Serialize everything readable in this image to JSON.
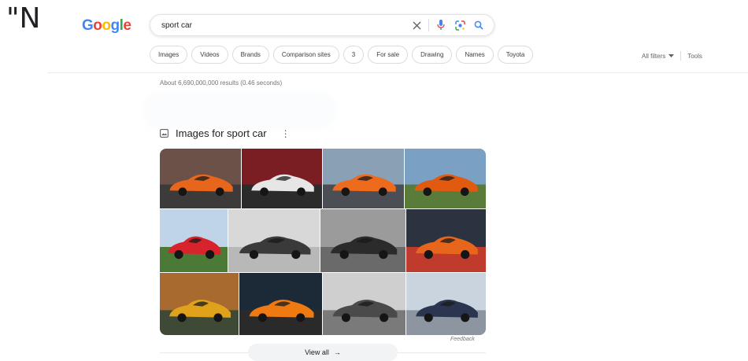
{
  "stray_text": "\"N",
  "logo": {
    "letters": [
      "G",
      "o",
      "o",
      "g",
      "l",
      "e"
    ],
    "colors": [
      "#4285F4",
      "#EA4335",
      "#FBBC05",
      "#4285F4",
      "#34A853",
      "#EA4335"
    ]
  },
  "search": {
    "query": "sport car",
    "icons": [
      "clear-icon",
      "voice-search-icon",
      "lens-icon",
      "search-icon"
    ]
  },
  "chips": [
    "Images",
    "Videos",
    "Brands",
    "Comparison sites",
    "3",
    "For sale",
    "Drawing",
    "Names",
    "Toyota"
  ],
  "tools": {
    "all_filters": "All filters",
    "tools": "Tools"
  },
  "results_stats": "About 6,690,000,000 results (0.46 seconds)",
  "images_section": {
    "heading": "Images for sport car",
    "tiles": [
      {
        "car": "#e8661c",
        "bg": "#6b5148",
        "ground": "#3d3a3a"
      },
      {
        "car": "#e6e6e6",
        "bg": "#7b1e24",
        "ground": "#2b2b2b"
      },
      {
        "car": "#ee6a1d",
        "bg": "#8aa1b5",
        "ground": "#4b4f55"
      },
      {
        "car": "#e25a10",
        "bg": "#7aa0c4",
        "ground": "#5a7c3a"
      },
      {
        "car": "#d9232c",
        "bg": "#bfd4e6",
        "ground": "#4a7a36"
      },
      {
        "car": "#3a3a3a",
        "bg": "#d8d8d8",
        "ground": "#b8b8b8"
      },
      {
        "car": "#2b2b2b",
        "bg": "#9b9b9b",
        "ground": "#6a6a6a"
      },
      {
        "car": "#e8661c",
        "bg": "#2b3340",
        "ground": "#c03a2e"
      },
      {
        "car": "#e0a21a",
        "bg": "#a86a2e",
        "ground": "#3e4a35"
      },
      {
        "car": "#f07a12",
        "bg": "#1c2a38",
        "ground": "#2a2a2a"
      },
      {
        "car": "#4a4a4a",
        "bg": "#cfcfcf",
        "ground": "#7a7a7a"
      },
      {
        "car": "#2c3550",
        "bg": "#c9d4df",
        "ground": "#8c95a0"
      }
    ],
    "feedback": "Feedback",
    "view_all": "View all"
  }
}
